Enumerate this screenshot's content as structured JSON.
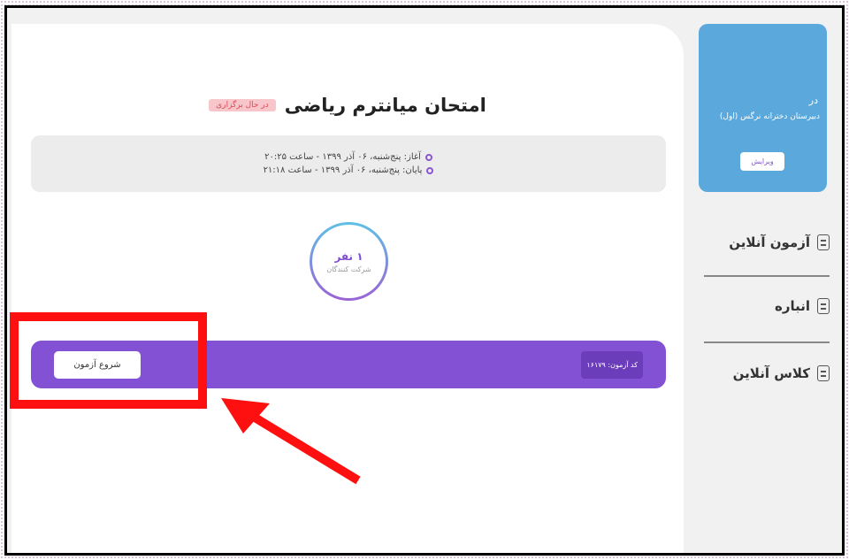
{
  "exam": {
    "title": "امتحان میانترم ریاضی",
    "status_badge": "در حال برگزاری",
    "start_time": "آغاز: پنج‌شنبه، ۰۶ آذر ۱۳۹۹ - ساعت ۲۰:۲۵",
    "end_time": "پایان: پنج‌شنبه، ۰۶ آذر ۱۳۹۹ - ساعت ۲۱:۱۸",
    "participant_count": "۱ نفر",
    "participant_label": "شرکت کنندگان",
    "exam_code": "کد آزمون: ۱۶۱۷۹",
    "start_button": "شروع آزمون"
  },
  "sidebar": {
    "card_in": "در",
    "school_name": "دبیرستان دخترانه نرگس (اول)",
    "edit_button": "ویرایش",
    "items": [
      {
        "label": "آزمون آنلاین",
        "icon": "checklist-icon"
      },
      {
        "label": "انباره",
        "icon": "storage-icon"
      },
      {
        "label": "کلاس آنلاین",
        "icon": "presentation-icon"
      }
    ]
  },
  "colors": {
    "purple": "#8251d4",
    "sidebar_card": "#5ba9dc",
    "highlight": "#ff1010"
  }
}
